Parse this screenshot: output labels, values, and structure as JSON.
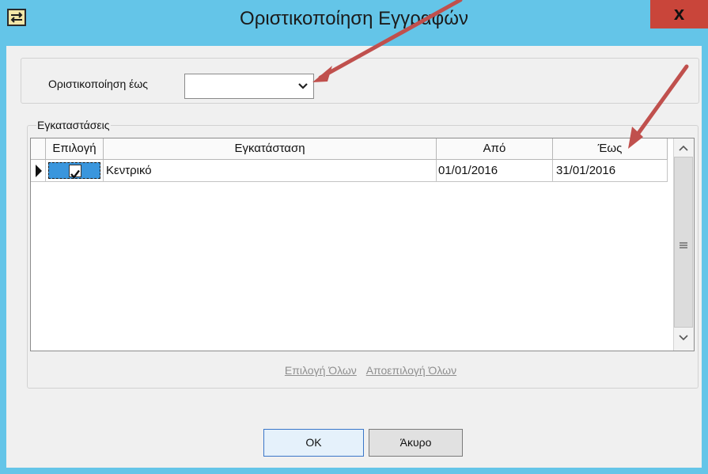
{
  "window": {
    "title": "Οριστικοποίηση Εγγραφών",
    "close_glyph": "x"
  },
  "finalize": {
    "label": "Οριστικοποίηση έως",
    "value": ""
  },
  "installations": {
    "group_label": "Εγκαταστάσεις",
    "columns": [
      "Επιλογή",
      "Εγκατάσταση",
      "Από",
      "Έως"
    ],
    "rows": [
      {
        "selected": true,
        "installation": "Κεντρικό",
        "from": "01/01/2016",
        "to": "31/01/2016"
      }
    ]
  },
  "links": {
    "select_all": "Επιλογή Όλων",
    "deselect_all": "Αποεπιλογή Όλων"
  },
  "buttons": {
    "ok": "OK",
    "cancel": "Άκυρο"
  },
  "colors": {
    "titlebar": "#64c5e8",
    "annotation_arrow": "#c0504d"
  }
}
